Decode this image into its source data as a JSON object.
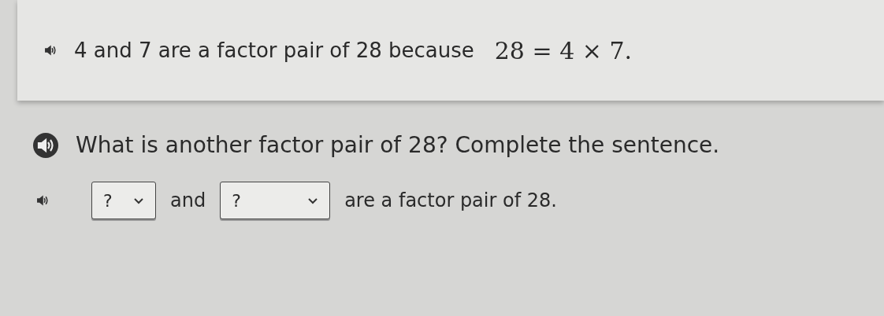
{
  "fact": {
    "text": "4 and 7 are a factor pair of 28 because",
    "math": "28 = 4 × 7."
  },
  "question": {
    "text": "What is another factor pair of 28? Complete the sentence."
  },
  "sentence": [
    {
      "kind": "dropdown",
      "value": "?"
    },
    {
      "kind": "text",
      "text": "and"
    },
    {
      "kind": "dropdown",
      "value": "?"
    },
    {
      "kind": "text",
      "text": "are a factor pair of 28."
    }
  ]
}
